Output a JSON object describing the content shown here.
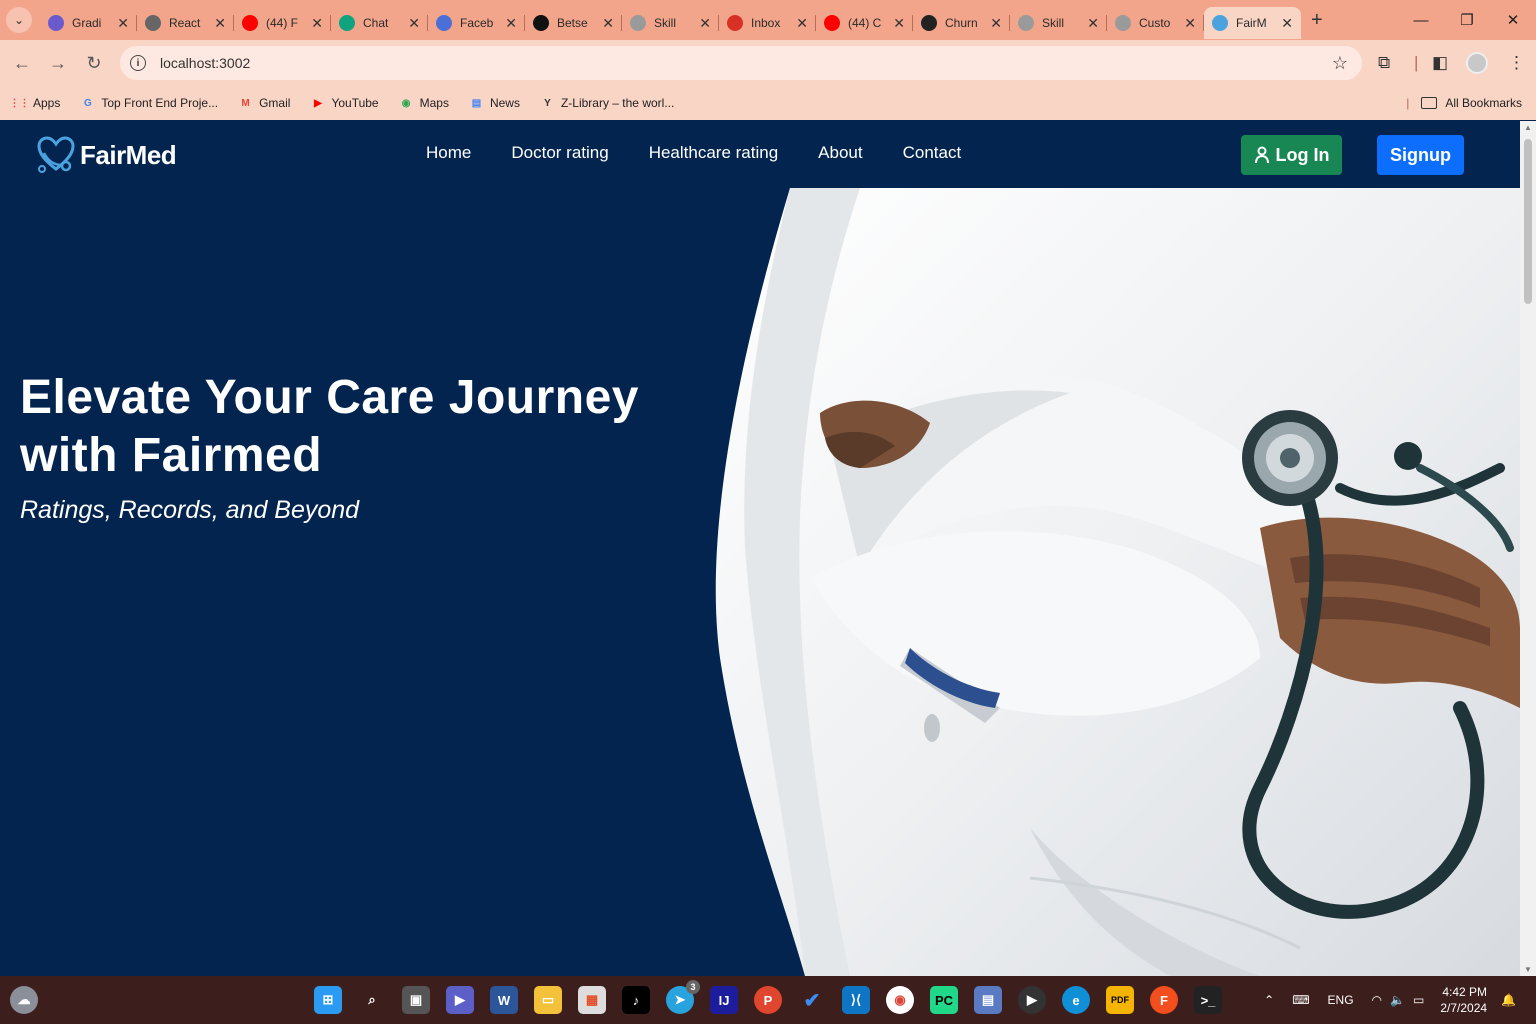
{
  "browser": {
    "tabs": [
      {
        "title": "Gradi",
        "color": "#6a5acd"
      },
      {
        "title": "React",
        "color": "#666666"
      },
      {
        "title": "(44) F",
        "color": "#ff0000"
      },
      {
        "title": "Chat",
        "color": "#10a37f"
      },
      {
        "title": "Faceb",
        "color": "#4b6fd6"
      },
      {
        "title": "Betse",
        "color": "#111111"
      },
      {
        "title": "Skill",
        "color": "#9a9a9a"
      },
      {
        "title": "Inbox",
        "color": "#d93025"
      },
      {
        "title": "(44) C",
        "color": "#ff0000"
      },
      {
        "title": "Churn",
        "color": "#222222"
      },
      {
        "title": "Skill",
        "color": "#9a9a9a"
      },
      {
        "title": "Custo",
        "color": "#9a9a9a"
      },
      {
        "title": "FairM",
        "color": "#4aa3df"
      }
    ],
    "url": "localhost:3002",
    "bookmarks": [
      {
        "label": "Apps",
        "icon": "apps-grid-icon"
      },
      {
        "label": "Top Front End Proje...",
        "icon": "google-icon"
      },
      {
        "label": "Gmail",
        "icon": "gmail-icon"
      },
      {
        "label": "YouTube",
        "icon": "youtube-icon"
      },
      {
        "label": "Maps",
        "icon": "maps-icon"
      },
      {
        "label": "News",
        "icon": "news-icon"
      },
      {
        "label": "Z-Library – the worl...",
        "icon": "zlibrary-icon"
      }
    ],
    "all_bookmarks": "All Bookmarks"
  },
  "site": {
    "brand": "FairMed",
    "nav": [
      "Home",
      "Doctor rating",
      "Healthcare rating",
      "About",
      "Contact"
    ],
    "login_label": "Log In",
    "signup_label": "Signup",
    "hero_title": "Elevate Your Care Journey with Fairmed",
    "hero_subtitle": "Ratings, Records, and Beyond",
    "colors": {
      "bg": "#02244f",
      "login": "#198754",
      "signup": "#0d6efd"
    }
  },
  "taskbar": {
    "lang": "ENG",
    "time": "4:42 PM",
    "date": "2/7/2024",
    "telegram_badge": "3"
  }
}
